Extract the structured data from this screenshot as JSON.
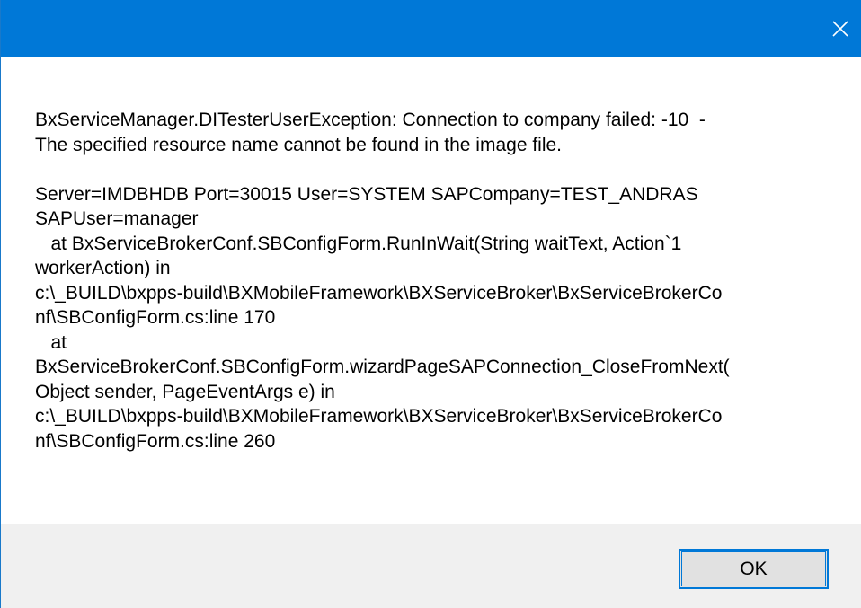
{
  "window": {
    "titlebar_color": "#0078d7",
    "close_icon": "close-icon"
  },
  "message": {
    "lines": [
      "BxServiceManager.DITesterUserException: Connection to company failed: -10  -",
      "The specified resource name cannot be found in the image file.",
      "",
      "Server=IMDBHDB Port=30015 User=SYSTEM SAPCompany=TEST_ANDRAS",
      "SAPUser=manager",
      "   at BxServiceBrokerConf.SBConfigForm.RunInWait(String waitText, Action`1",
      "workerAction) in",
      "c:\\_BUILD\\bxpps-build\\BXMobileFramework\\BXServiceBroker\\BxServiceBrokerCo",
      "nf\\SBConfigForm.cs:line 170",
      "   at",
      "BxServiceBrokerConf.SBConfigForm.wizardPageSAPConnection_CloseFromNext(",
      "Object sender, PageEventArgs e) in",
      "c:\\_BUILD\\bxpps-build\\BXMobileFramework\\BXServiceBroker\\BxServiceBrokerCo",
      "nf\\SBConfigForm.cs:line 260"
    ]
  },
  "footer": {
    "ok_label": "OK"
  }
}
